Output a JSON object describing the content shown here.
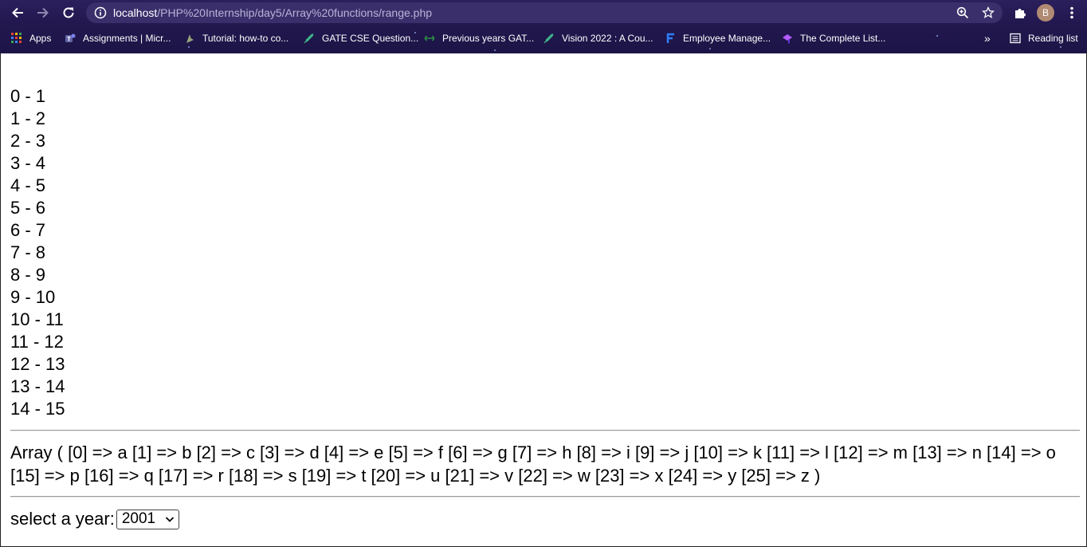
{
  "browser": {
    "url_host": "localhost",
    "url_path": "/PHP%20Internship/day5/Array%20functions/range.php",
    "profile_initial": "B",
    "reading_list_label": "Reading list",
    "bookmarks": [
      {
        "label": "Apps",
        "icon": "apps-grid-icon"
      },
      {
        "label": "Assignments | Micr...",
        "icon": "teams-icon"
      },
      {
        "label": "Tutorial: how-to co...",
        "icon": "tutorial-icon"
      },
      {
        "label": "GATE CSE Question...",
        "icon": "rocket-icon"
      },
      {
        "label": "Previous years GAT...",
        "icon": "gfg-icon"
      },
      {
        "label": "Vision 2022 : A Cou...",
        "icon": "rocket-icon"
      },
      {
        "label": "Employee Manage...",
        "icon": "f-logo-icon"
      },
      {
        "label": "The Complete List...",
        "icon": "hat-icon"
      }
    ],
    "colors": {
      "frame": "#22184f",
      "omnibox": "#3a2f6b"
    }
  },
  "content": {
    "range_lines": [
      "0 - 1",
      "1 - 2",
      "2 - 3",
      "3 - 4",
      "4 - 5",
      "5 - 6",
      "6 - 7",
      "7 - 8",
      "8 - 9",
      "9 - 10",
      "10 - 11",
      "11 - 12",
      "12 - 13",
      "13 - 14",
      "14 - 15"
    ],
    "array_dump": "Array ( [0] => a [1] => b [2] => c [3] => d [4] => e [5] => f [6] => g [7] => h [8] => i [9] => j [10] => k [11] => l [12] => m [13] => n [14] => o [15] => p [16] => q [17] => r [18] => s [19] => t [20] => u [21] => v [22] => w [23] => x [24] => y [25] => z )",
    "year_label": "select a year:",
    "year_selected": "2001"
  }
}
